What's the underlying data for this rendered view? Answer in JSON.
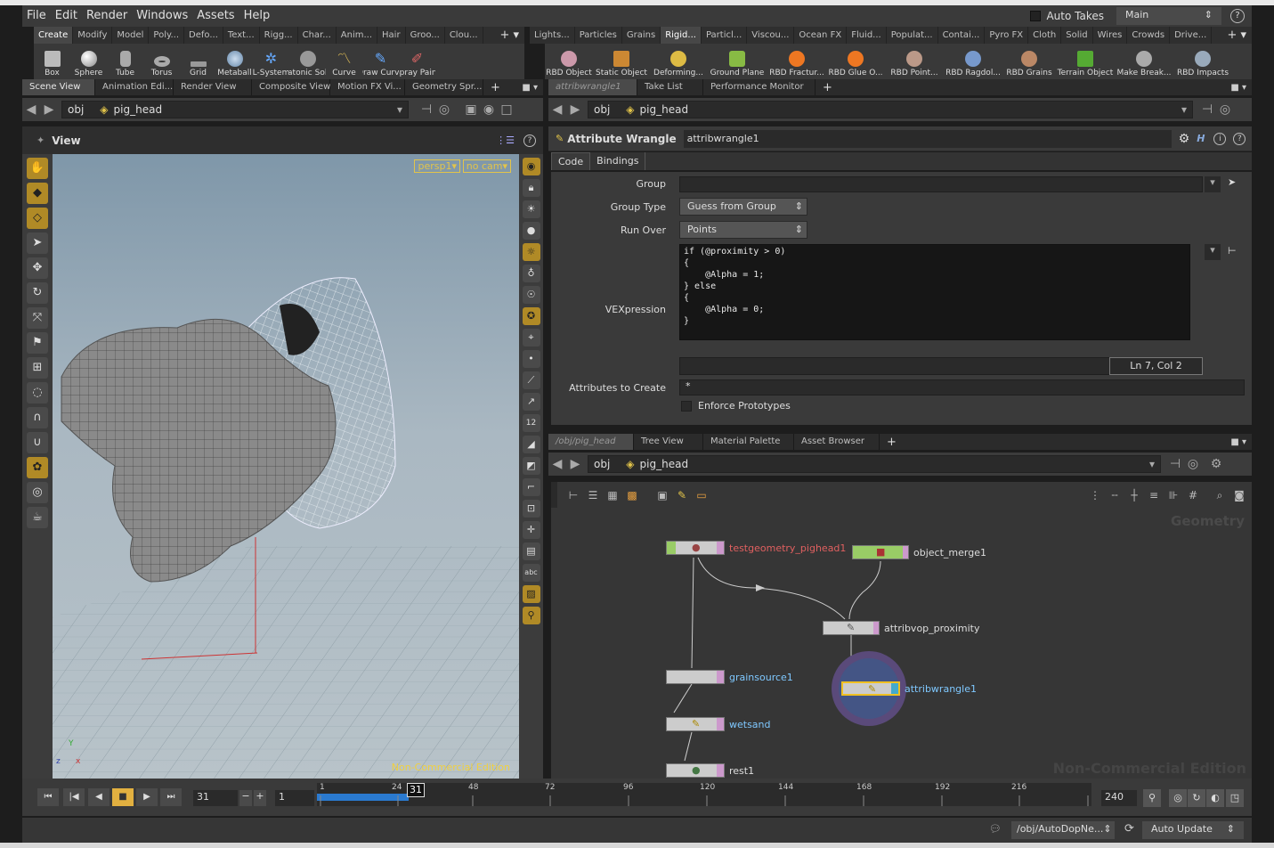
{
  "menu": [
    "File",
    "Edit",
    "Render",
    "Windows",
    "Assets",
    "Help"
  ],
  "auto_takes_label": "Auto Takes",
  "desktop": "Main",
  "shelf_left_tabs": [
    "Create",
    "Modify",
    "Model",
    "Poly...",
    "Defo...",
    "Text...",
    "Rigg...",
    "Char...",
    "Anim...",
    "Hair",
    "Groo...",
    "Clou..."
  ],
  "shelf_right_tabs": [
    "Lights...",
    "Particles",
    "Grains",
    "Rigid...",
    "Particl...",
    "Viscou...",
    "Ocean FX",
    "Fluid...",
    "Populat...",
    "Contai...",
    "Pyro FX",
    "Cloth",
    "Solid",
    "Wires",
    "Crowds",
    "Drive..."
  ],
  "shelf_left_tools": [
    "Box",
    "Sphere",
    "Tube",
    "Torus",
    "Grid",
    "Metaball",
    "L-System",
    "Platonic Sol...",
    "Curve",
    "Draw Curve",
    "Spray Paint"
  ],
  "shelf_right_tools": [
    "RBD Object",
    "Static Object",
    "Deforming...",
    "Ground Plane",
    "RBD Fractur...",
    "RBD Glue O...",
    "RBD Point...",
    "RBD Ragdol...",
    "RBD Grains",
    "Terrain Object",
    "Make Break...",
    "RBD Impacts"
  ],
  "left_pane_tabs": [
    "Scene View",
    "Animation Edi...",
    "Render View",
    "Composite View",
    "Motion FX Vi...",
    "Geometry Spr..."
  ],
  "path": {
    "root": "obj",
    "node": "pig_head"
  },
  "view_label": "View",
  "camera": {
    "persp": "persp1▾",
    "cam": "no cam▾"
  },
  "watermark": "Non-Commercial Edition",
  "param_pane_tabs": [
    "attribwrangle1",
    "Take List",
    "Performance Monitor"
  ],
  "param": {
    "type": "Attribute Wrangle",
    "name": "attribwrangle1",
    "tabs": [
      "Code",
      "Bindings"
    ],
    "group_label": "Group",
    "group_value": "",
    "group_type_label": "Group Type",
    "group_type_value": "Guess from Group",
    "run_over_label": "Run Over",
    "run_over_value": "Points",
    "vex_label": "VEXpression",
    "code": "if (@proximity > 0)\n{\n    @Alpha = 1;\n} else\n{\n    @Alpha = 0;\n}",
    "cursor_pos": "Ln 7, Col 2",
    "attrs_label": "Attributes to Create",
    "attrs_value": "*",
    "enforce_label": "Enforce Prototypes"
  },
  "net_pane_tabs": [
    "/obj/pig_head",
    "Tree View",
    "Material Palette",
    "Asset Browser"
  ],
  "net_context": "Geometry",
  "nodes": {
    "testgeo": "testgeometry_pighead1",
    "merge": "object_merge1",
    "vop": "attribvop_proximity",
    "wrangle": "attribwrangle1",
    "grain": "grainsource1",
    "wetsand": "wetsand",
    "rest": "rest1"
  },
  "timeline": {
    "current_frame": "31",
    "start": "1",
    "end": "240",
    "ticks": [
      "1",
      "24",
      "48",
      "72",
      "96",
      "120",
      "144",
      "168",
      "192",
      "216"
    ],
    "marker": "31"
  },
  "status": {
    "path": "/obj/AutoDopNe...",
    "update": "Auto Update"
  },
  "colors": {
    "accent": "#e2c44a",
    "selected_node": "#f0c020",
    "node_label_red": "#e06060",
    "node_label_blue": "#7fc8ff"
  }
}
